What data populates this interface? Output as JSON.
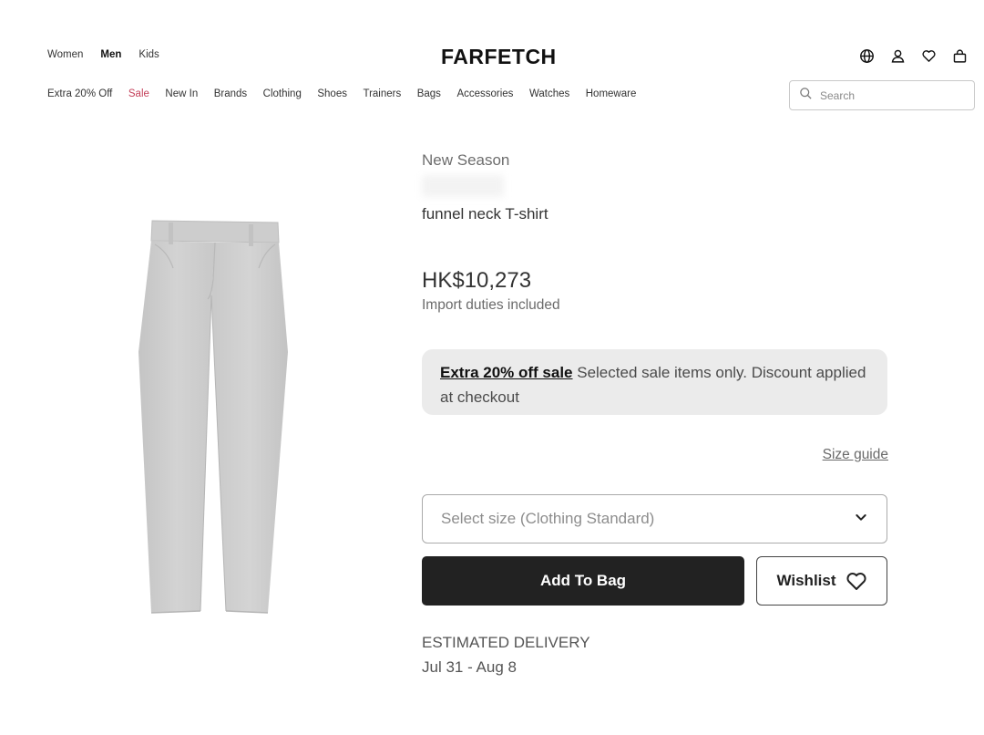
{
  "header": {
    "gender_nav": [
      {
        "label": "Women",
        "active": false
      },
      {
        "label": "Men",
        "active": true
      },
      {
        "label": "Kids",
        "active": false
      }
    ],
    "logo": "FARFETCH",
    "utility_icons": [
      "globe-icon",
      "account-icon",
      "heart-icon",
      "bag-icon"
    ],
    "categories": [
      "Extra 20% Off",
      "Sale",
      "New In",
      "Brands",
      "Clothing",
      "Shoes",
      "Trainers",
      "Bags",
      "Accessories",
      "Watches",
      "Homeware"
    ],
    "search": {
      "placeholder": "Search",
      "value": ""
    }
  },
  "product": {
    "season": "New Season",
    "name": "funnel neck T-shirt",
    "price": "HK$10,273",
    "duties": "Import duties included",
    "promo": {
      "link": "Extra 20% off sale",
      "text": " Selected sale items only. Discount applied at checkout"
    },
    "size_guide": "Size guide",
    "size_select": {
      "placeholder": "Select size (Clothing Standard)"
    },
    "add_to_bag": "Add To Bag",
    "wishlist": "Wishlist",
    "delivery_label": "ESTIMATED DELIVERY",
    "delivery_dates": "Jul 31 - Aug 8"
  },
  "colors": {
    "sale": "#c4405a",
    "primary_button": "#222222",
    "promo_bg": "#ebebeb",
    "garment": "#cfcfcf"
  }
}
